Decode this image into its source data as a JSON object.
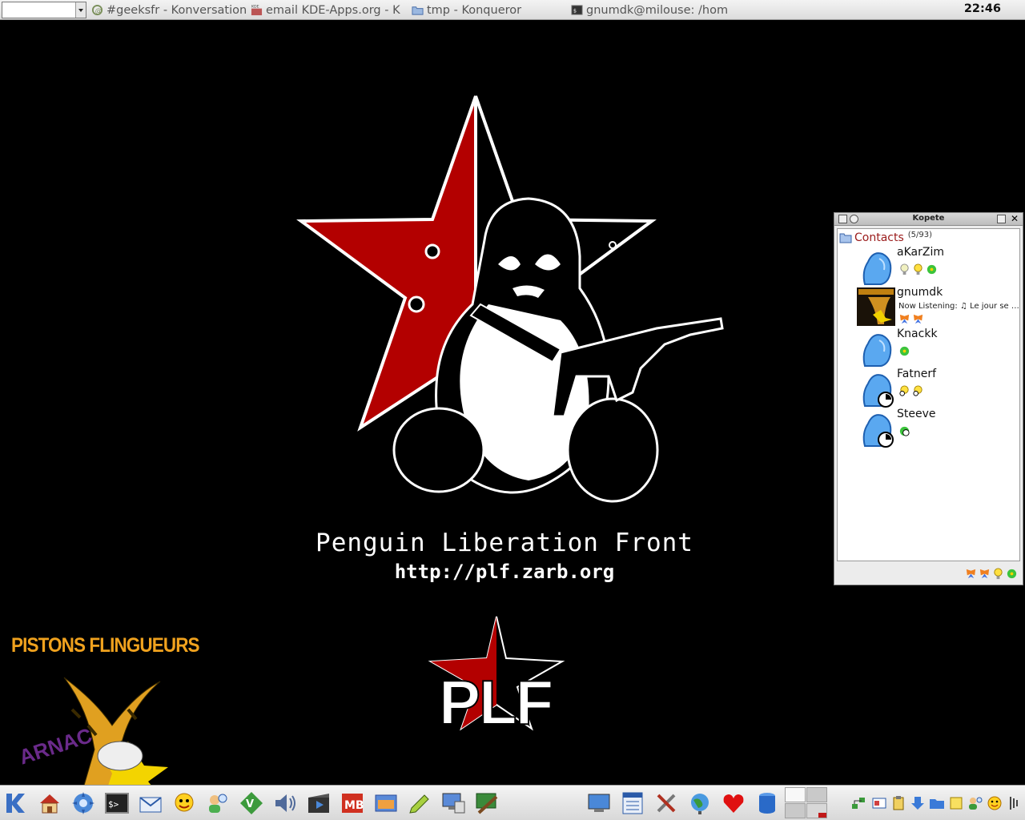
{
  "taskbar": {
    "tasks": [
      {
        "label": "#geeksfr - Konversation",
        "icon": "konversation-icon"
      },
      {
        "label": "email KDE-Apps.org - K",
        "icon": "kde-app-icon"
      },
      {
        "label": "tmp - Konqueror",
        "icon": "folder-icon"
      },
      {
        "label": "gnumdk@milouse: /hom",
        "icon": "terminal-icon"
      }
    ],
    "clock": "22:46"
  },
  "wallpaper": {
    "title": "Penguin Liberation Front",
    "url": "http://plf.zarb.org",
    "corner_logo_title": "PISTONS FLINGUEURS",
    "corner_logo_subtitle": "ARNAC",
    "bottom_logo_text": "PLF",
    "colors": {
      "red": "#b30000",
      "white": "#ffffff",
      "black": "#000000",
      "orange": "#f0a21e"
    }
  },
  "kopete": {
    "title": "Kopete",
    "group": {
      "name": "Contacts",
      "count": "(5/93)"
    },
    "contacts": [
      {
        "name": "aKarZim",
        "status": "",
        "icons": [
          "bulb-icon",
          "bulb-icon",
          "icq-flower-icon"
        ]
      },
      {
        "name": "gnumdk",
        "status": "Now Listening: ♫ Le jour se …",
        "icons": [
          "msn-butterfly-icon",
          "msn-butterfly-icon"
        ]
      },
      {
        "name": "Knackk",
        "status": "",
        "icons": [
          "icq-flower-icon"
        ]
      },
      {
        "name": "Fatnerf",
        "status": "",
        "icons": [
          "bulb-away-icon",
          "bulb-away-icon"
        ]
      },
      {
        "name": "Steeve",
        "status": "",
        "icons": [
          "icq-away-icon"
        ]
      }
    ],
    "status_bar_icons": [
      "msn-butterfly-icon",
      "msn-butterfly-icon",
      "bulb-icon",
      "icq-flower-icon"
    ]
  },
  "panel": {
    "launchers": [
      "kde-menu-icon",
      "home-icon",
      "konqueror-icon",
      "konsole-icon",
      "kmail-icon",
      "kopete-icon",
      "users-icon",
      "vim-icon",
      "volume-icon",
      "video-icon",
      "mb-icon",
      "window-icon",
      "pencil-icon",
      "remote-desktop-icon",
      "network-tool-icon"
    ],
    "applets": [
      "monitor-icon",
      "window-list-icon",
      "tools-icon",
      "globe-icon",
      "heart-icon",
      "database-icon"
    ],
    "tray": [
      "network-icon",
      "card-icon",
      "klipper-icon",
      "download-icon",
      "folder-icon",
      "people-icon",
      "smiley-icon",
      "more-icon"
    ]
  }
}
